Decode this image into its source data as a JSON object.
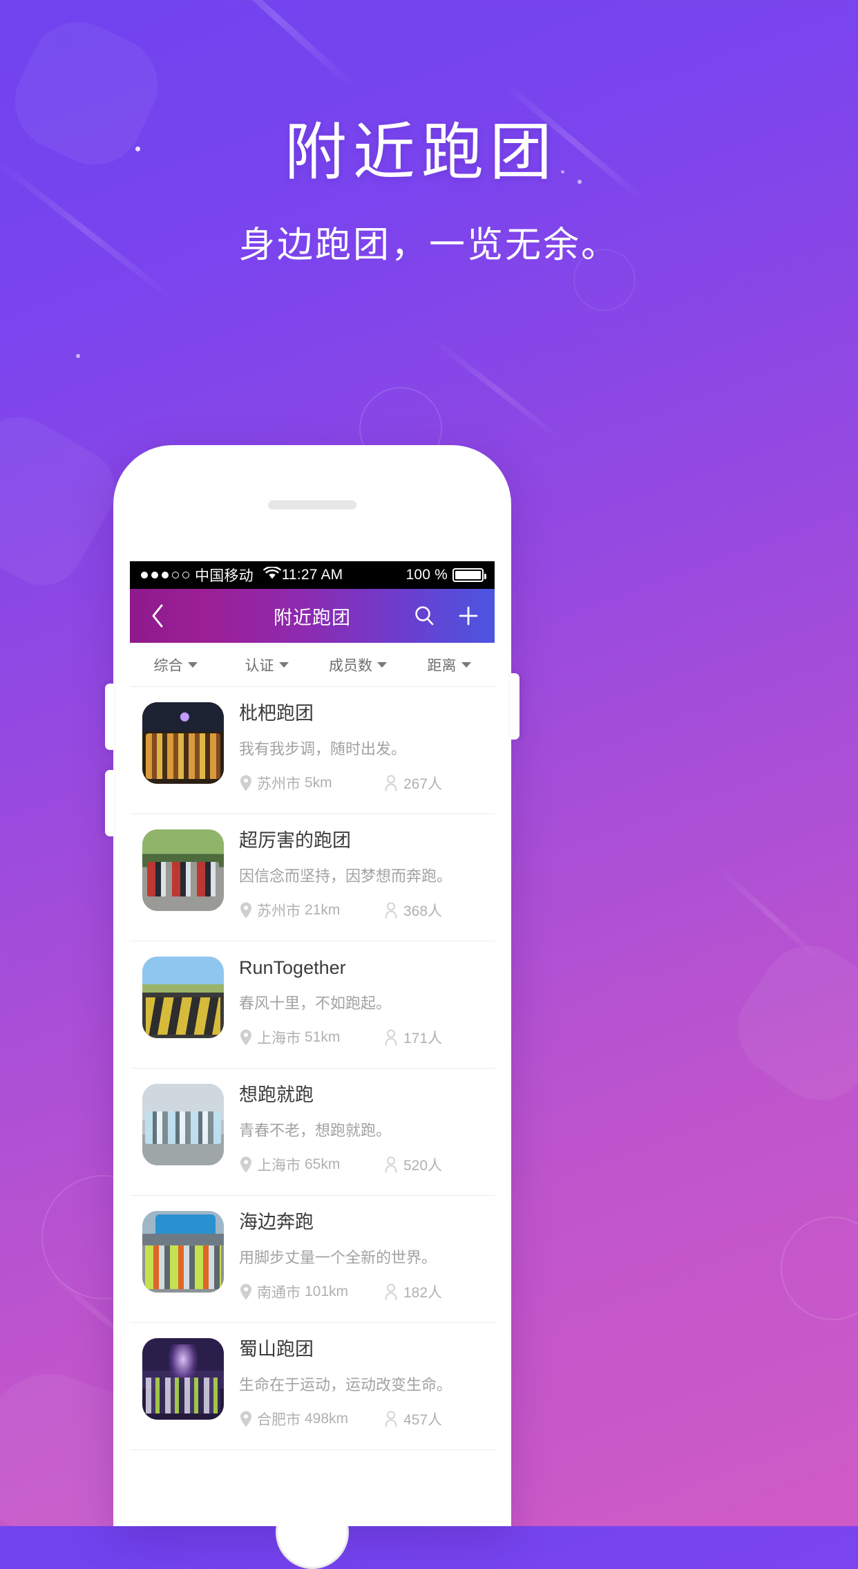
{
  "hero": {
    "title": "附近跑团",
    "subtitle": "身边跑团，一览无余。"
  },
  "colors": {
    "bg_start": "#6f43ef",
    "bg_end": "#cf5bc6",
    "nav_start": "#8d1a8d",
    "nav_end": "#4b56e0",
    "title_text": "#3b3b3b",
    "desc_text": "#a2a2a2",
    "meta_text": "#b0b0b0"
  },
  "status_bar": {
    "signal_filled": 3,
    "signal_total": 5,
    "carrier": "中国移动",
    "wifi_icon": "wifi-icon",
    "time": "11:27 AM",
    "battery_percent": "100 %",
    "battery_icon": "battery-full-icon"
  },
  "navbar": {
    "back_icon": "chevron-left-icon",
    "title": "附近跑团",
    "search_icon": "search-icon",
    "add_icon": "plus-icon"
  },
  "filters": [
    {
      "label": "综合",
      "icon": "chevron-down-icon"
    },
    {
      "label": "认证",
      "icon": "chevron-down-icon"
    },
    {
      "label": "成员数",
      "icon": "chevron-down-icon"
    },
    {
      "label": "距离",
      "icon": "chevron-down-icon"
    }
  ],
  "list_meta": {
    "location_icon": "map-pin-icon",
    "member_icon": "person-icon"
  },
  "teams": [
    {
      "name": "枇杷跑团",
      "slogan": "我有我步调，随时出发。",
      "city": "苏州市",
      "distance": "5km",
      "members": "267人",
      "thumb": "crowd-night-photo"
    },
    {
      "name": "超厉害的跑团",
      "slogan": "因信念而坚持，因梦想而奔跑。",
      "city": "苏州市",
      "distance": "21km",
      "members": "368人",
      "thumb": "road-green-photo"
    },
    {
      "name": "RunTogether",
      "slogan": "春风十里，不如跑起。",
      "city": "上海市",
      "distance": "51km",
      "members": "171人",
      "thumb": "runtogether-poster-photo"
    },
    {
      "name": "想跑就跑",
      "slogan": "青春不老，想跑就跑。",
      "city": "上海市",
      "distance": "65km",
      "members": "520人",
      "thumb": "city-runners-photo"
    },
    {
      "name": "海边奔跑",
      "slogan": "用脚步丈量一个全新的世界。",
      "city": "南通市",
      "distance": "101km",
      "members": "182人",
      "thumb": "seaside-race-photo"
    },
    {
      "name": "蜀山跑团",
      "slogan": "生命在于运动，运动改变生命。",
      "city": "合肥市",
      "distance": "498km",
      "members": "457人",
      "thumb": "stage-night-photo"
    }
  ]
}
